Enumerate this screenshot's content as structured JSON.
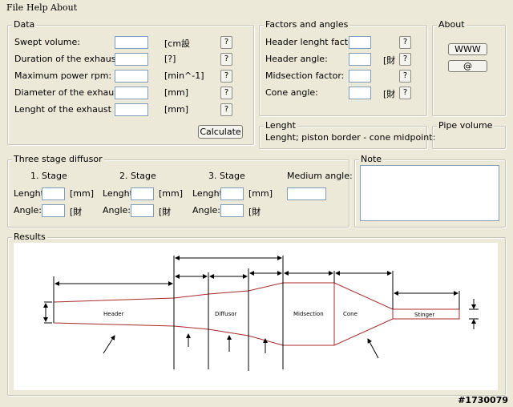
{
  "menu": [
    "File",
    "Help",
    "About"
  ],
  "data_group": {
    "title": "Data",
    "rows": [
      {
        "label": "Swept volume:",
        "unit": "[cm設"
      },
      {
        "label": "Duration of the exhaust port:",
        "unit": "[?]"
      },
      {
        "label": "Maximum power rpm:",
        "unit": "[min^-1]"
      },
      {
        "label": "Diameter of the exhaust port:",
        "unit": "[mm]"
      },
      {
        "label": "Lenght of the exhaust port:",
        "unit": "[mm]"
      }
    ],
    "help_label": "?",
    "calculate_label": "Calculate"
  },
  "factors_group": {
    "title": "Factors and angles",
    "rows": [
      {
        "label": "Header lenght factor:",
        "unit": ""
      },
      {
        "label": "Header angle:",
        "unit": "[財"
      },
      {
        "label": "Midsection factor:",
        "unit": ""
      },
      {
        "label": "Cone angle:",
        "unit": "[財"
      }
    ],
    "help_label": "?"
  },
  "about_group": {
    "title": "About",
    "www_label": "WWW",
    "at_label": "@"
  },
  "lenght_group": {
    "title": "Lenght",
    "text": "Lenght; piston border - cone midpoint:"
  },
  "pipe_group": {
    "title": "Pipe volume"
  },
  "diffusor_group": {
    "title": "Three stage diffusor",
    "stages": [
      "1. Stage",
      "2. Stage",
      "3. Stage"
    ],
    "medium_angle_label": "Medium angle:",
    "length_label": "Lenght:",
    "angle_label": "Angle:",
    "length_unit": "[mm]",
    "angle_unit": "[財"
  },
  "note_group": {
    "title": "Note"
  },
  "results_group": {
    "title": "Results",
    "sections": [
      "Header",
      "Diffusor",
      "Midsection",
      "Cone",
      "Stinger"
    ]
  },
  "watermark": "#1730079"
}
